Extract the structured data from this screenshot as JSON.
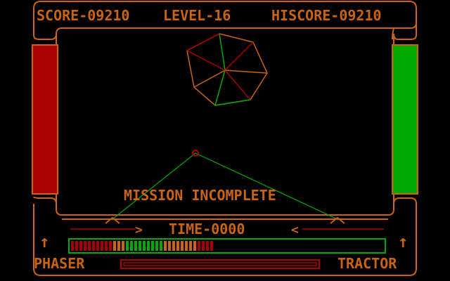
{
  "hud": {
    "score": "SCORE-09210",
    "level": "LEVEL-16",
    "hiscore": "HISCORE-09210",
    "message": "MISSION INCOMPLETE",
    "time": "TIME-0000",
    "phaser_label": "PHASER",
    "tractor_label": "TRACTOR",
    "left_arrow_glyph": ">",
    "right_arrow_glyph": "<",
    "up_arrow_glyph": "↑"
  },
  "gauges": {
    "energy_fill": 0.47,
    "phaser_fill": 1.0
  },
  "colors": {
    "frame": "#c86414",
    "red": "#aa0000",
    "green": "#00aa00",
    "black": "#000000"
  },
  "icons": {
    "left_shield": "shield-bar-icon",
    "right_shield": "shield-bar-icon",
    "enemy": "wireframe-polygon-icon",
    "target": "targeting-cursor-icon"
  }
}
